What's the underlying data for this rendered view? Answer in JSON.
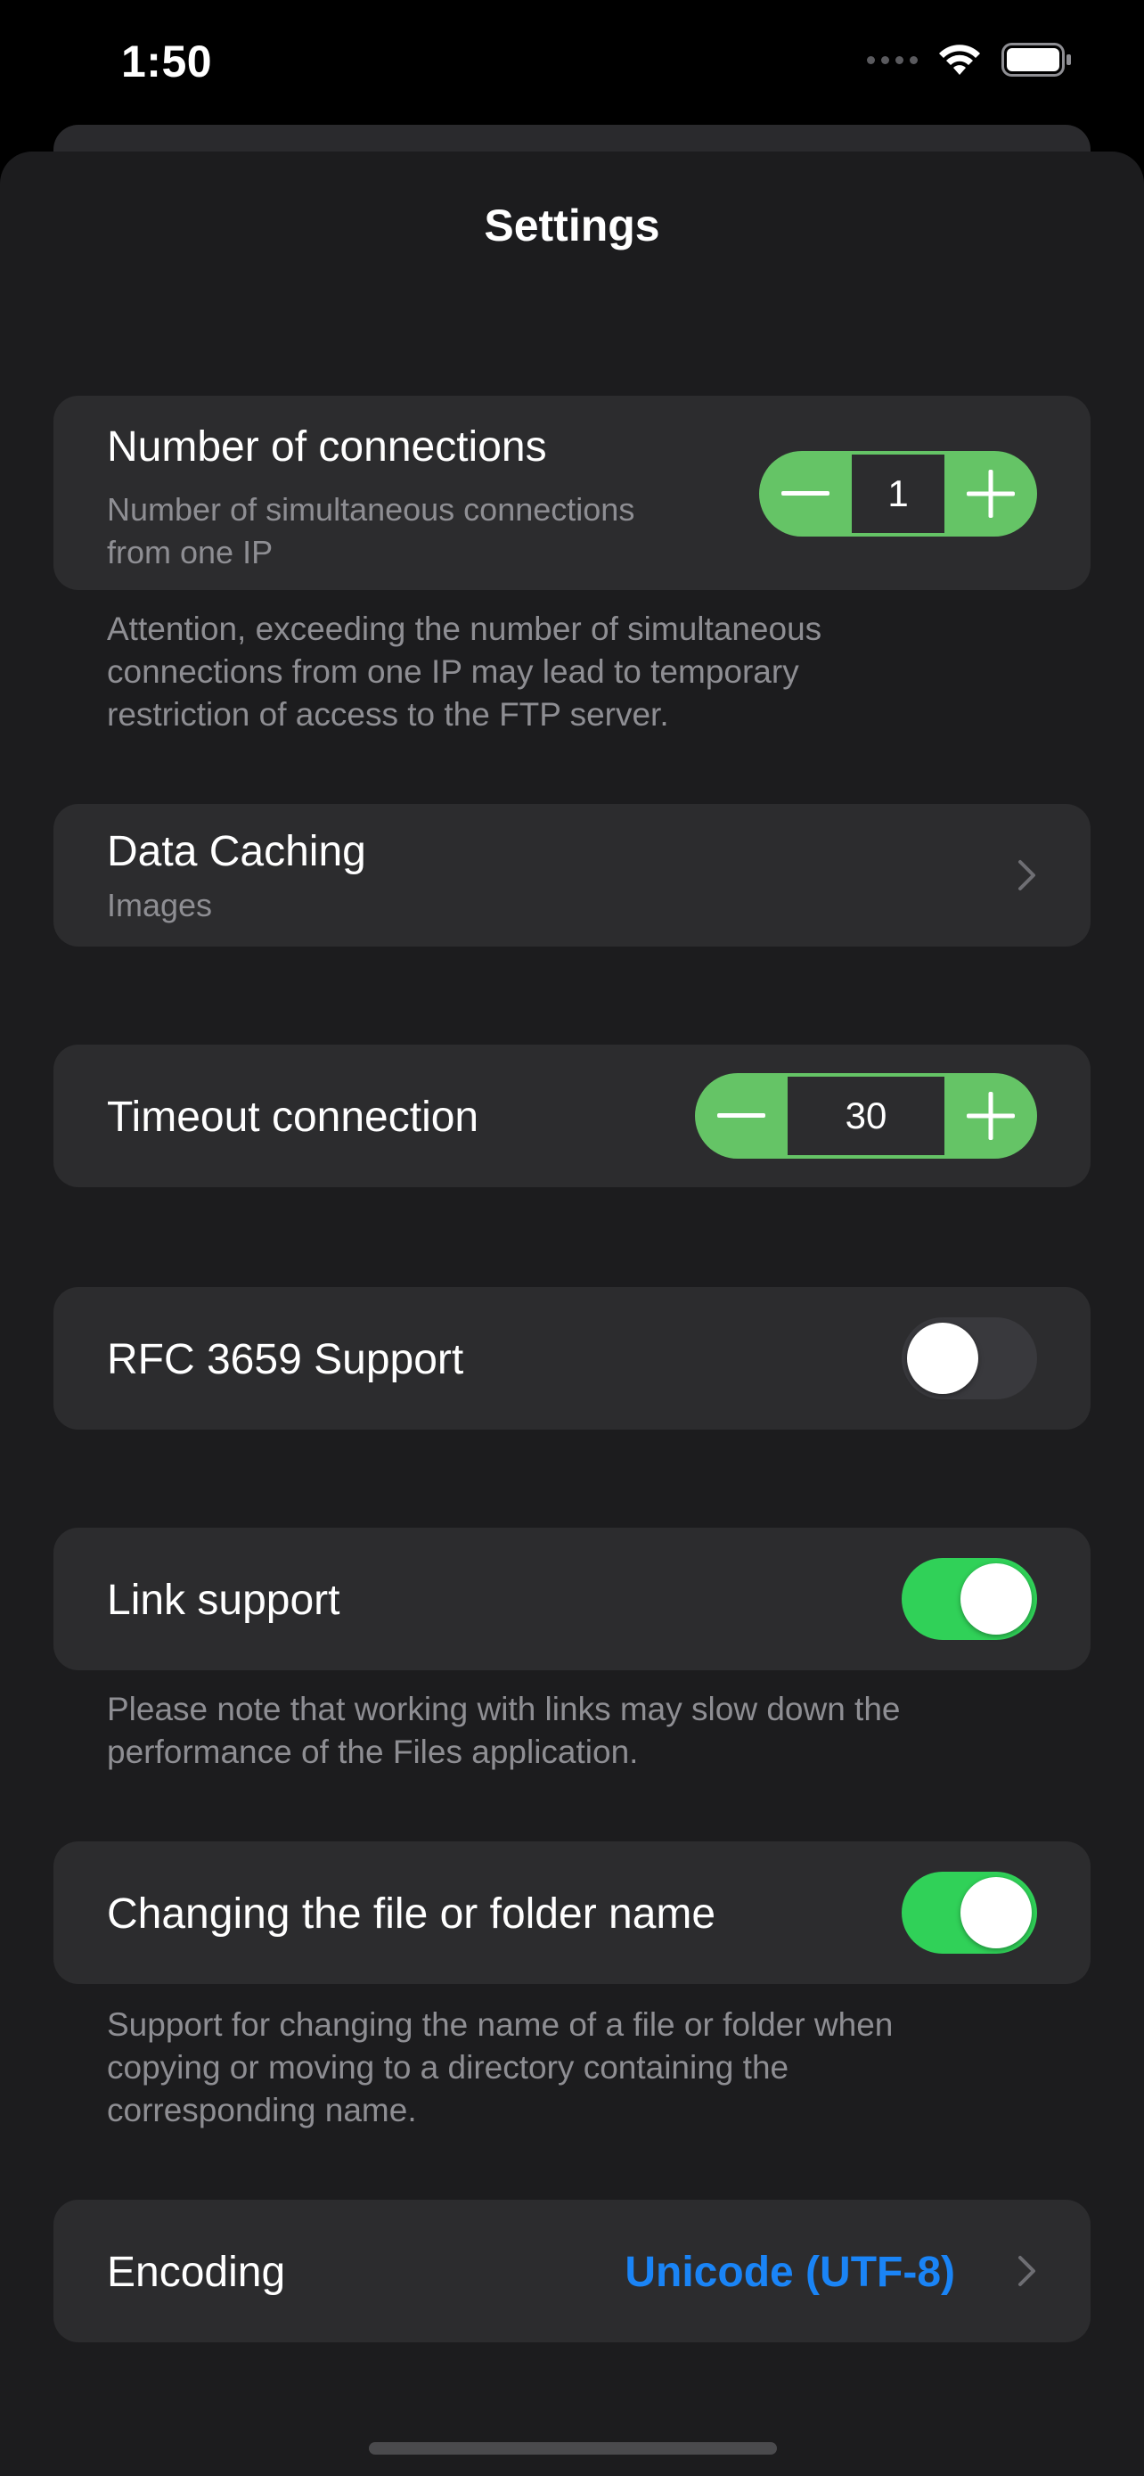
{
  "status_bar": {
    "time": "1:50",
    "icons": [
      "cellular-signal-icon",
      "wifi-icon",
      "battery-icon"
    ]
  },
  "sheet": {
    "title": "Settings"
  },
  "connections": {
    "title": "Number of connections",
    "subtitle_line1": "Number of simultaneous connections",
    "subtitle_line2": "from one IP",
    "value": "1",
    "footnote_line1": "Attention, exceeding the number of simultaneous",
    "footnote_line2": "connections from one IP may lead to temporary",
    "footnote_line3": "restriction of access to the FTP server."
  },
  "data_caching": {
    "title": "Data Caching",
    "subtitle": "Images"
  },
  "timeout": {
    "title": "Timeout connection",
    "value": "30"
  },
  "rfc": {
    "title": "RFC 3659 Support",
    "enabled": false
  },
  "link_support": {
    "title": "Link support",
    "enabled": true,
    "footnote_line1": "Please note that working with links may slow down the",
    "footnote_line2": "performance of the Files application."
  },
  "rename": {
    "title": "Changing the file or folder name",
    "enabled": true,
    "footnote_line1": "Support for changing the name of a file or folder when",
    "footnote_line2": "copying or moving to a directory containing the",
    "footnote_line3": "corresponding name."
  },
  "encoding": {
    "title": "Encoding",
    "value": "Unicode (UTF-8)"
  },
  "colors": {
    "accent_green": "#65c466",
    "toggle_on": "#30d158",
    "toggle_off": "#39393d",
    "link_blue": "#1a84f6",
    "background": "#1c1c1e",
    "card": "#2c2c2e",
    "secondary_text": "#8e8e93"
  }
}
